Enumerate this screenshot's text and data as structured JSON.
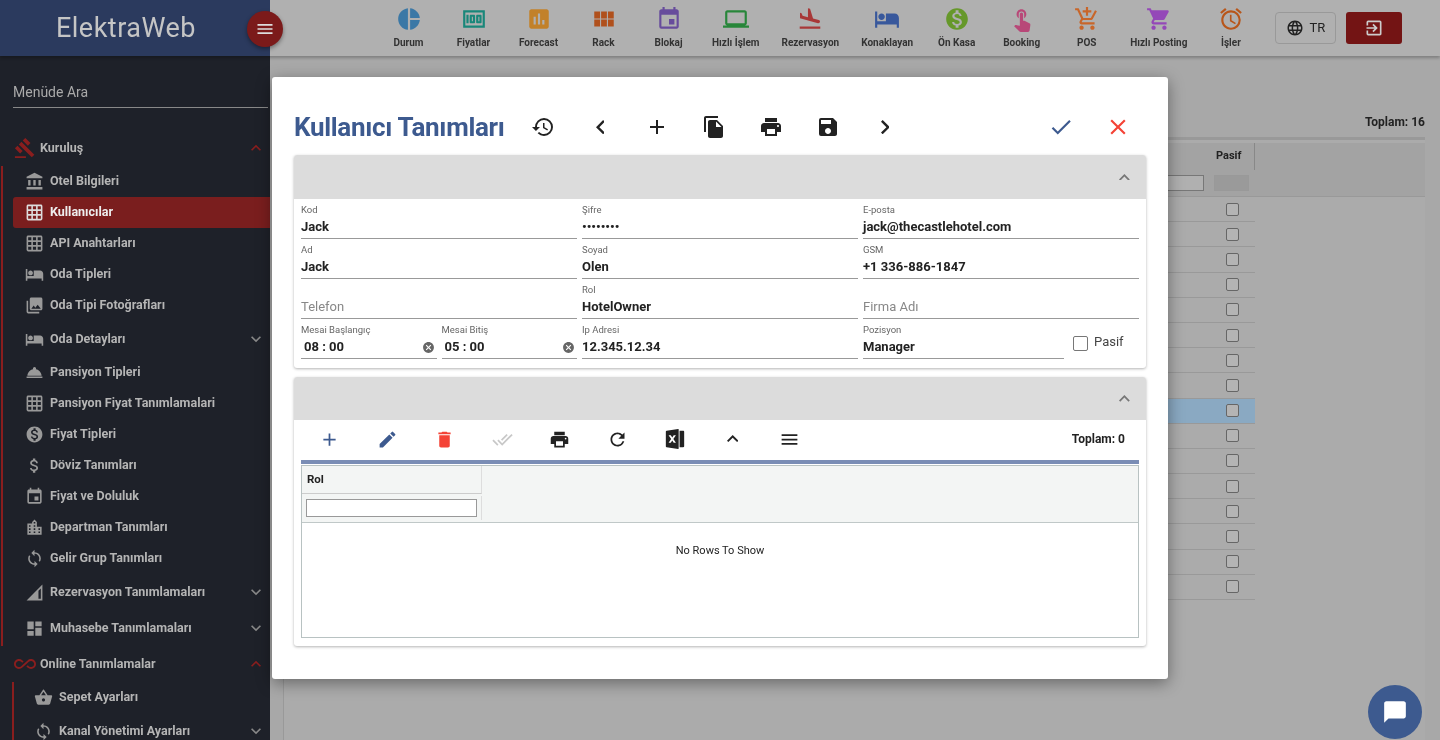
{
  "app": {
    "logo": "ElektraWeb",
    "language": "TR"
  },
  "nav": [
    {
      "label": "Durum"
    },
    {
      "label": "Fiyatlar"
    },
    {
      "label": "Forecast"
    },
    {
      "label": "Rack"
    },
    {
      "label": "Blokaj"
    },
    {
      "label": "Hızlı İşlem"
    },
    {
      "label": "Rezervasyon"
    },
    {
      "label": "Konaklayan"
    },
    {
      "label": "Ön Kasa"
    },
    {
      "label": "Booking"
    },
    {
      "label": "POS"
    },
    {
      "label": "Hızlı Posting"
    },
    {
      "label": "İşler"
    }
  ],
  "sidebar": {
    "search": {
      "placeholder": "Menüde Ara"
    },
    "items": [
      {
        "label": "Kuruluş",
        "expanded": true,
        "children": [
          {
            "label": "Otel Bilgileri",
            "selected": false
          },
          {
            "label": "Kullanıcılar",
            "selected": true
          },
          {
            "label": "API Anahtarları",
            "selected": false
          },
          {
            "label": "Oda Tipleri",
            "selected": false
          },
          {
            "label": "Oda Tipi Fotoğrafları",
            "selected": false
          },
          {
            "label": "Oda Detayları",
            "selected": false,
            "expanded": false
          },
          {
            "label": "Pansiyon Tipleri",
            "selected": false
          },
          {
            "label": "Pansiyon Fiyat Tanımlamalari",
            "selected": false
          },
          {
            "label": "Fiyat Tipleri",
            "selected": false
          },
          {
            "label": "Döviz Tanımları",
            "selected": false
          },
          {
            "label": "Fiyat ve Doluluk",
            "selected": false
          },
          {
            "label": "Departman Tanımları",
            "selected": false
          },
          {
            "label": "Gelir Grup Tanımları",
            "selected": false
          },
          {
            "label": "Rezervasyon Tanımlamaları",
            "selected": false,
            "expanded": false
          },
          {
            "label": "Muhasebe Tanımlamaları",
            "selected": false,
            "expanded": false
          }
        ]
      },
      {
        "label": "Online Tanımlamalar",
        "expanded": true,
        "children": [
          {
            "label": "Sepet Ayarları",
            "selected": false
          },
          {
            "label": "Kanal Yönetimi Ayarları",
            "selected": false,
            "expanded": false
          }
        ]
      }
    ]
  },
  "background": {
    "total": "Toplam: 16",
    "columns": [
      "Pasif"
    ],
    "rows": [
      {
        "pasif": false,
        "selected": false
      },
      {
        "pasif": false,
        "selected": false
      },
      {
        "pasif": false,
        "selected": false
      },
      {
        "pasif": false,
        "selected": false
      },
      {
        "pasif": false,
        "selected": false
      },
      {
        "pasif": false,
        "selected": false
      },
      {
        "pasif": false,
        "selected": false
      },
      {
        "pasif": false,
        "selected": false
      },
      {
        "pasif": false,
        "selected": true
      },
      {
        "pasif": false,
        "selected": false
      },
      {
        "pasif": false,
        "selected": false
      },
      {
        "pasif": false,
        "selected": false
      },
      {
        "pasif": false,
        "selected": false
      },
      {
        "pasif": false,
        "selected": false
      },
      {
        "pasif": false,
        "selected": false
      },
      {
        "pasif": false,
        "selected": false
      }
    ]
  },
  "modal": {
    "title": "Kullanıcı Tanımları",
    "form": {
      "expanded": true,
      "rows": [
        [
          {
            "kind": "text",
            "label": "Kod",
            "value": "Jack"
          },
          {
            "kind": "text",
            "label": "Şifre",
            "value": "••••••••"
          },
          {
            "kind": "text",
            "label": "E-posta",
            "value": "jack@thecastlehotel.com"
          }
        ],
        [
          {
            "kind": "text",
            "label": "Ad",
            "value": "Jack"
          },
          {
            "kind": "text",
            "label": "Soyad",
            "value": "Olen"
          },
          {
            "kind": "text",
            "label": "GSM",
            "value": "+1 336-886-1847"
          }
        ],
        [
          {
            "kind": "text",
            "placeholder": "Telefon"
          },
          {
            "kind": "text",
            "label": "Rol",
            "value": "HotelOwner"
          },
          {
            "kind": "text",
            "placeholder": "Firma Adı"
          }
        ],
        [
          {
            "kind": "pair",
            "fields": [
              {
                "kind": "time",
                "label": "Mesai Başlangıç",
                "value": "08 : 00"
              },
              {
                "kind": "time",
                "label": "Mesai Bitiş",
                "value": "05 : 00"
              }
            ]
          },
          {
            "kind": "text",
            "label": "Ip Adresi",
            "value": "12.345.12.34"
          },
          {
            "kind": "pair",
            "fields": [
              {
                "kind": "text",
                "label": "Pozisyon",
                "value": "Manager"
              },
              {
                "kind": "checkbox",
                "label": "Pasif",
                "checked": false
              }
            ]
          }
        ]
      ]
    },
    "grid": {
      "expanded": true,
      "tools": [
        {
          "disabled": false
        },
        {
          "disabled": false
        },
        {
          "disabled": false
        },
        {
          "disabled": true
        },
        {
          "disabled": false
        },
        {
          "disabled": false
        },
        {
          "disabled": false
        },
        {
          "disabled": false
        },
        {
          "disabled": false
        }
      ],
      "total": "Toplam: 0",
      "columns": [
        "Rol"
      ],
      "empty": "No Rows To Show"
    }
  }
}
